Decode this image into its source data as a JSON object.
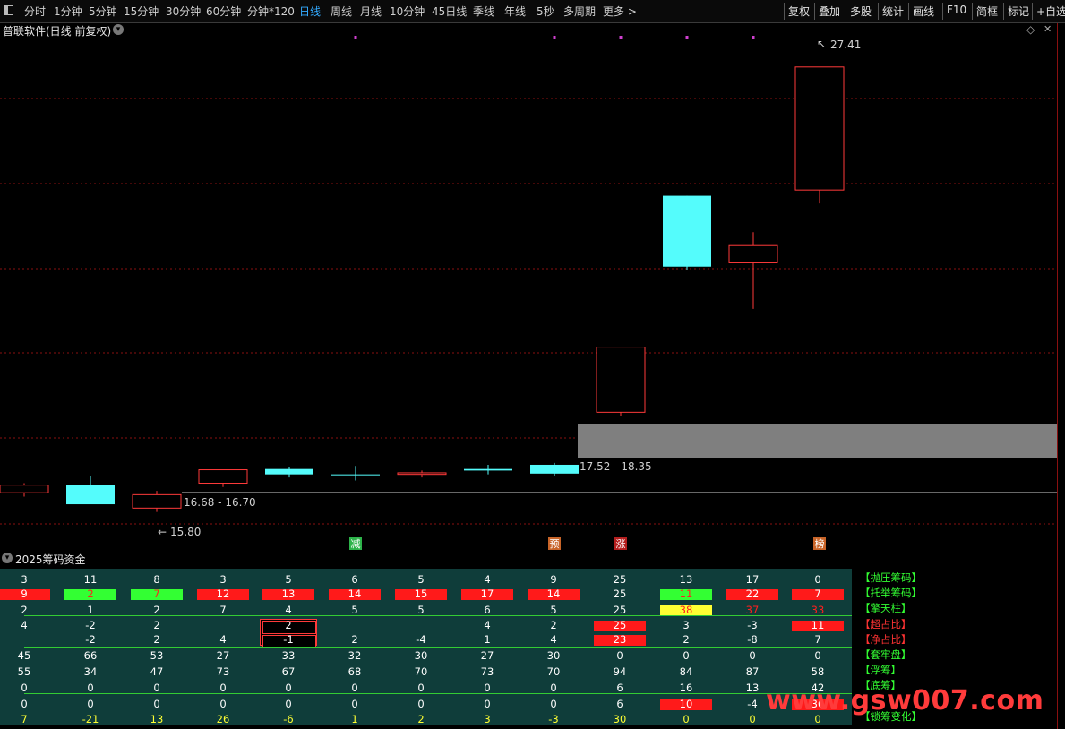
{
  "toolbar": {
    "periods": [
      "分时",
      "1分钟",
      "5分钟",
      "15分钟",
      "30分钟",
      "60分钟",
      "分钟*120",
      "日线",
      "周线",
      "月线",
      "10分钟",
      "45日线",
      "季线",
      "年线",
      "5秒",
      "多周期",
      "更多 >"
    ],
    "active_period": "日线",
    "right_buttons": [
      "复权",
      "叠加",
      "多股",
      "统计",
      "画线",
      "F10",
      "简框",
      "标记",
      "+自选"
    ]
  },
  "chart": {
    "title": "普联软件(日线 前复权)",
    "high_label": "27.41",
    "low_label": "15.80",
    "zone1_label": "16.68 - 16.70",
    "zone2_label": "17.52 - 18.35",
    "colors": {
      "up": "#ff3a3a",
      "down": "#54fcfc",
      "zone": "#7f7f7f",
      "grid": "#8a1010"
    }
  },
  "chart_data": {
    "type": "candlestick",
    "title": "普联软件(日线 前复权)",
    "ylim": [
      15.3,
      28.2
    ],
    "candles": [
      {
        "dir": "up",
        "o": 16.3,
        "c": 16.5,
        "h": 16.55,
        "l": 16.2
      },
      {
        "dir": "down",
        "o": 16.5,
        "c": 16.0,
        "h": 16.75,
        "l": 16.0
      },
      {
        "dir": "up",
        "o": 15.9,
        "c": 16.25,
        "h": 16.35,
        "l": 15.8
      },
      {
        "dir": "up",
        "o": 16.55,
        "c": 16.9,
        "h": 16.9,
        "l": 16.45
      },
      {
        "dir": "down",
        "o": 16.92,
        "c": 16.78,
        "h": 16.98,
        "l": 16.7
      },
      {
        "dir": "down",
        "o": 16.78,
        "c": 16.76,
        "h": 17.0,
        "l": 16.62
      },
      {
        "dir": "up",
        "o": 16.78,
        "c": 16.82,
        "h": 16.88,
        "l": 16.7
      },
      {
        "dir": "down",
        "o": 16.92,
        "c": 16.88,
        "h": 17.03,
        "l": 16.78
      },
      {
        "dir": "down",
        "o": 17.03,
        "c": 16.8,
        "h": 17.08,
        "l": 16.73
      },
      {
        "dir": "up",
        "o": 18.4,
        "c": 20.1,
        "h": 20.1,
        "l": 18.3
      },
      {
        "dir": "down",
        "o": 24.05,
        "c": 22.2,
        "h": 24.05,
        "l": 22.1
      },
      {
        "dir": "up",
        "o": 22.3,
        "c": 22.75,
        "h": 23.1,
        "l": 21.1
      },
      {
        "dir": "up",
        "o": 24.2,
        "c": 27.41,
        "h": 27.41,
        "l": 23.85
      }
    ],
    "zones": [
      {
        "low": 16.68,
        "high": 16.7,
        "label": "16.68 - 16.70"
      },
      {
        "low": 17.52,
        "high": 18.35,
        "label": "17.52 - 18.35"
      }
    ],
    "annotations": [
      "27.41",
      "15.80"
    ]
  },
  "signals": [
    {
      "text": "减",
      "col": 5,
      "color": "#2db34a"
    },
    {
      "text": "预",
      "col": 8,
      "color": "#c86428"
    },
    {
      "text": "涨",
      "col": 9,
      "color": "#b41e1e"
    },
    {
      "text": "榜",
      "col": 12,
      "color": "#c86428"
    }
  ],
  "indicator": {
    "title": "2025筹码资金",
    "rows": [
      {
        "label": "【抛压筹码】",
        "label_color": "#33ff33",
        "cells": [
          "3",
          "11",
          "8",
          "3",
          "5",
          "6",
          "5",
          "4",
          "9",
          "25",
          "13",
          "17",
          "0"
        ],
        "text_colors": [
          "w",
          "w",
          "w",
          "w",
          "w",
          "w",
          "w",
          "w",
          "w",
          "w",
          "w",
          "w",
          "w"
        ],
        "bgs": [
          "",
          "",
          "",
          "",
          "",
          "",
          "",
          "",
          "",
          "",
          "",
          "",
          ""
        ]
      },
      {
        "label": "【托举筹码】",
        "label_color": "#33ff33",
        "cells": [
          "9",
          "2",
          "7",
          "12",
          "13",
          "14",
          "15",
          "17",
          "14",
          "25",
          "11",
          "22",
          "7"
        ],
        "text_colors": [
          "w",
          "r",
          "r",
          "w",
          "w",
          "w",
          "w",
          "w",
          "w",
          "w",
          "r",
          "w",
          "w"
        ],
        "bgs": [
          "red",
          "green",
          "green",
          "red",
          "red",
          "red",
          "red",
          "red",
          "red",
          "",
          "green",
          "red",
          "red"
        ]
      },
      {
        "label": "【擎天柱】",
        "label_color": "#33ff33",
        "cells": [
          "2",
          "1",
          "2",
          "7",
          "4",
          "5",
          "5",
          "6",
          "5",
          "25",
          "38",
          "37",
          "33"
        ],
        "text_colors": [
          "w",
          "w",
          "w",
          "w",
          "w",
          "w",
          "w",
          "w",
          "w",
          "w",
          "r",
          "r",
          "r"
        ],
        "bgs": [
          "",
          "",
          "",
          "",
          "",
          "",
          "",
          "",
          "",
          "",
          "yellow",
          "",
          ""
        ]
      },
      {
        "label": "【超占比】",
        "label_color": "#ff3333",
        "cells": [
          "4",
          "-2",
          "2",
          "",
          "2",
          "",
          "",
          "4",
          "2",
          "25",
          "3",
          "-3",
          "11"
        ],
        "text_colors": [
          "w",
          "w",
          "w",
          "w",
          "w",
          "w",
          "w",
          "w",
          "w",
          "w",
          "w",
          "w",
          "w"
        ],
        "bgs": [
          "",
          "",
          "",
          "",
          "black",
          "",
          "",
          "",
          "",
          "red",
          "",
          "",
          "red"
        ]
      },
      {
        "label": "【净占比】",
        "label_color": "#ff3333",
        "cells": [
          "",
          "-2",
          "2",
          "4",
          "-1",
          "2",
          "-4",
          "1",
          "4",
          "23",
          "2",
          "-8",
          "7"
        ],
        "text_colors": [
          "w",
          "w",
          "w",
          "w",
          "w",
          "w",
          "w",
          "w",
          "w",
          "w",
          "w",
          "w",
          "w"
        ],
        "bgs": [
          "",
          "",
          "",
          "",
          "black",
          "",
          "",
          "",
          "",
          "red",
          "",
          "",
          ""
        ]
      },
      {
        "label": "【套牢盘】",
        "label_color": "#33ff33",
        "cells": [
          "45",
          "66",
          "53",
          "27",
          "33",
          "32",
          "30",
          "27",
          "30",
          "0",
          "0",
          "0",
          "0"
        ],
        "text_colors": [
          "w",
          "w",
          "w",
          "w",
          "w",
          "w",
          "w",
          "w",
          "w",
          "w",
          "w",
          "w",
          "w"
        ],
        "bgs": [
          "",
          "",
          "",
          "",
          "",
          "",
          "",
          "",
          "",
          "",
          "",
          "",
          ""
        ]
      },
      {
        "label": "【浮筹】",
        "label_color": "#33ff33",
        "cells": [
          "55",
          "34",
          "47",
          "73",
          "67",
          "68",
          "70",
          "73",
          "70",
          "94",
          "84",
          "87",
          "58"
        ],
        "text_colors": [
          "w",
          "w",
          "w",
          "w",
          "w",
          "w",
          "w",
          "w",
          "w",
          "w",
          "w",
          "w",
          "w"
        ],
        "bgs": [
          "",
          "",
          "",
          "",
          "",
          "",
          "",
          "",
          "",
          "",
          "",
          "",
          ""
        ]
      },
      {
        "label": "【底筹】",
        "label_color": "#33ff33",
        "cells": [
          "0",
          "0",
          "0",
          "0",
          "0",
          "0",
          "0",
          "0",
          "0",
          "6",
          "16",
          "13",
          "42"
        ],
        "text_colors": [
          "w",
          "w",
          "w",
          "w",
          "w",
          "w",
          "w",
          "w",
          "w",
          "w",
          "w",
          "w",
          "w"
        ],
        "bgs": [
          "",
          "",
          "",
          "",
          "",
          "",
          "",
          "",
          "",
          "",
          "",
          "",
          ""
        ]
      },
      {
        "label": "",
        "label_color": "#33ff33",
        "cells": [
          "0",
          "0",
          "0",
          "0",
          "0",
          "0",
          "0",
          "0",
          "0",
          "6",
          "10",
          "-4",
          "30"
        ],
        "text_colors": [
          "w",
          "w",
          "w",
          "w",
          "w",
          "w",
          "w",
          "w",
          "w",
          "w",
          "w",
          "w",
          "w"
        ],
        "bgs": [
          "",
          "",
          "",
          "",
          "",
          "",
          "",
          "",
          "",
          "",
          "red",
          "",
          "red"
        ]
      },
      {
        "label": "【锁筹变化】",
        "label_color": "#33ff33",
        "cells": [
          "7",
          "-21",
          "13",
          "26",
          "-6",
          "1",
          "2",
          "3",
          "-3",
          "30",
          "0",
          "0",
          "0"
        ],
        "text_colors": [
          "y",
          "y",
          "y",
          "y",
          "y",
          "y",
          "y",
          "y",
          "y",
          "y",
          "y",
          "y",
          "y"
        ],
        "bgs": [
          "",
          "",
          "",
          "",
          "",
          "",
          "",
          "",
          "",
          "",
          "",
          "",
          ""
        ]
      }
    ]
  },
  "watermark": "www.gsw007.com"
}
